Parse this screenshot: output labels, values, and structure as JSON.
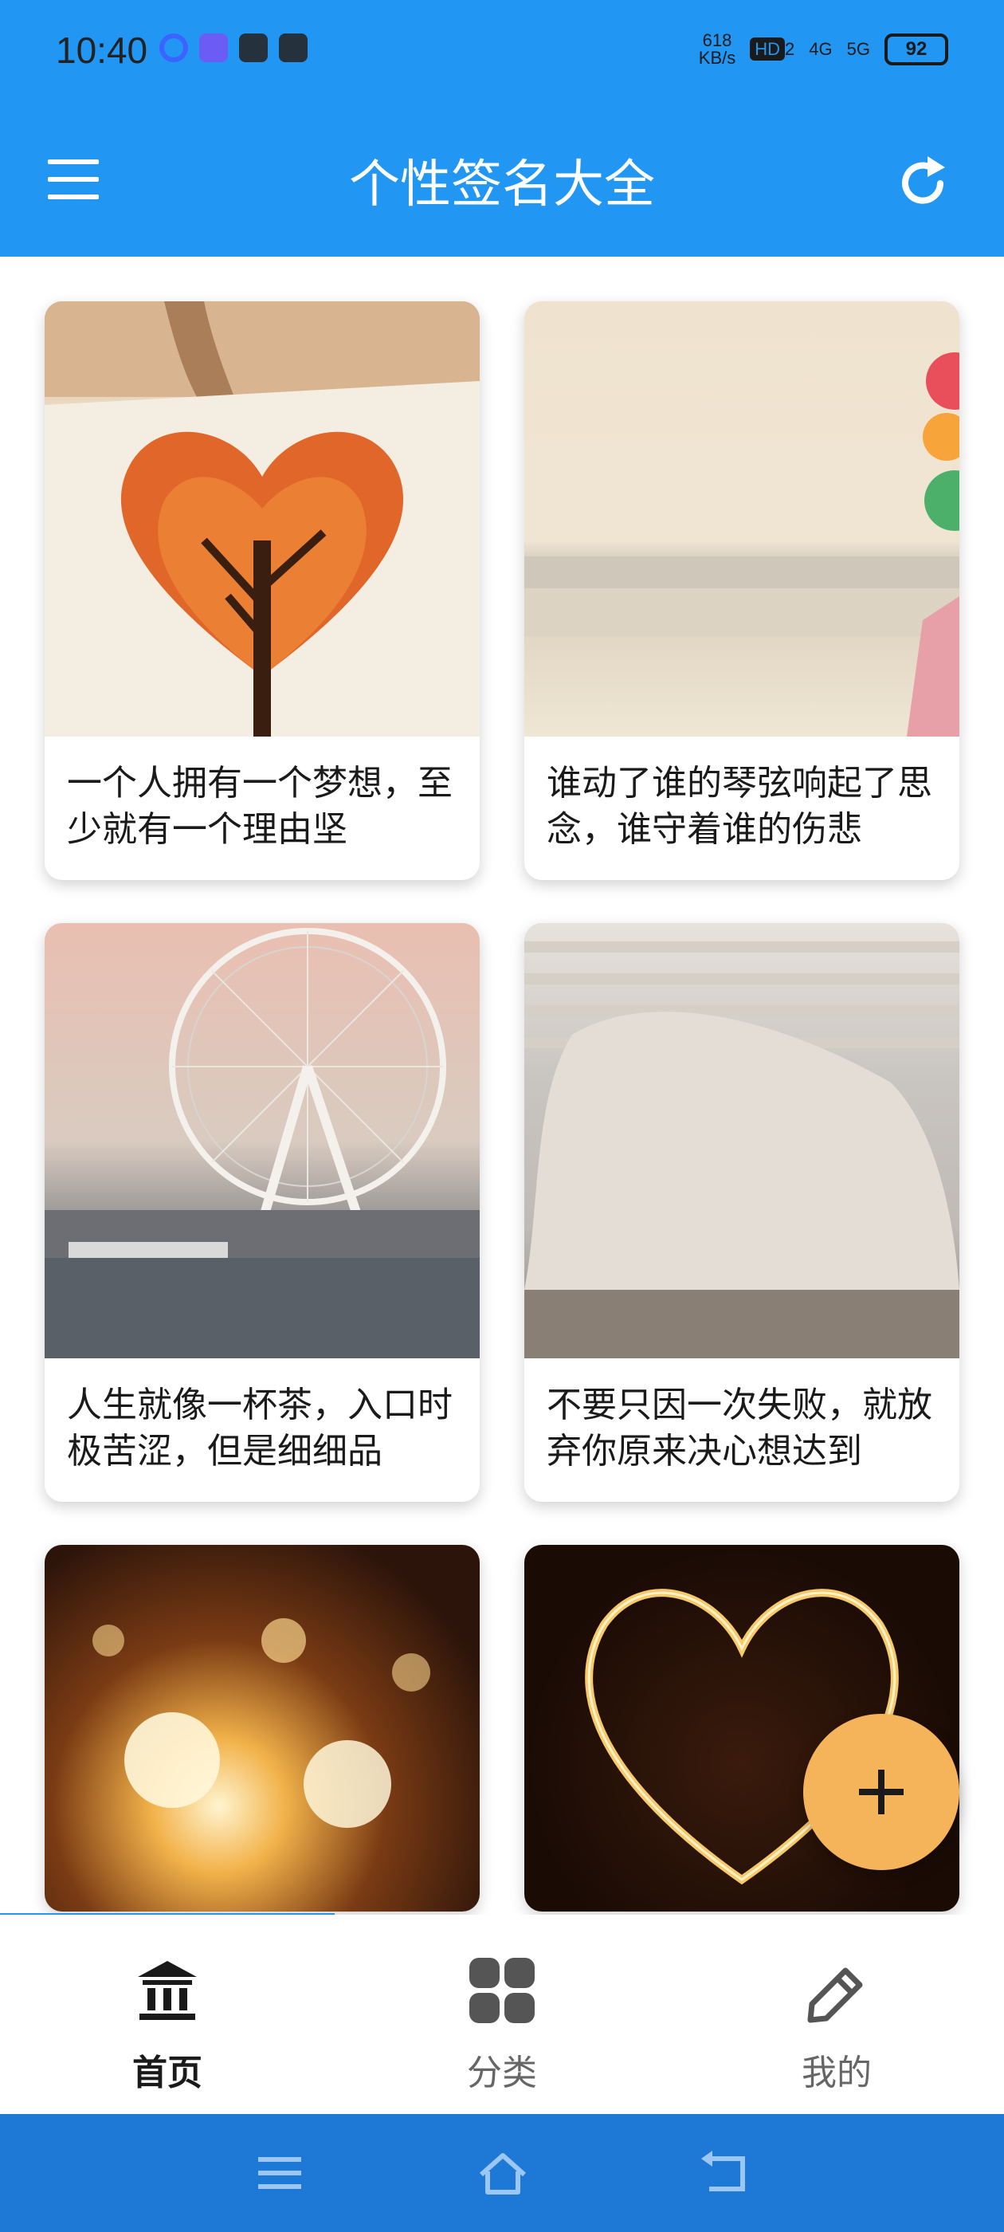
{
  "status_bar": {
    "time": "10:40",
    "net_speed_value": "618",
    "net_speed_unit": "KB/s",
    "hd_badge": "HD",
    "hd_sub": "2",
    "signal_4g": "4G",
    "signal_5g": "5G",
    "battery": "92"
  },
  "app_bar": {
    "title": "个性签名大全"
  },
  "cards": [
    {
      "text": "一个人拥有一个梦想，至少就有一个理由坚"
    },
    {
      "text": "谁动了谁的琴弦响起了思念，谁守着谁的伤悲"
    },
    {
      "text": "人生就像一杯茶，入口时极苦涩，但是细细品"
    },
    {
      "text": "不要只因一次失败，就放弃你原来决心想达到"
    },
    {
      "text": ""
    },
    {
      "text": ""
    }
  ],
  "bottom_nav": {
    "items": [
      {
        "label": "首页",
        "icon": "bank-icon"
      },
      {
        "label": "分类",
        "icon": "grid-icon"
      },
      {
        "label": "我的",
        "icon": "pencil-icon"
      }
    ],
    "active_index": 0
  },
  "fab": {
    "icon": "plus-icon"
  },
  "system_nav": {
    "icons": [
      "menu-icon",
      "home-icon",
      "back-icon"
    ]
  },
  "colors": {
    "primary": "#2196f3",
    "fab": "#f5b45a",
    "system_nav": "#1e78d6"
  }
}
